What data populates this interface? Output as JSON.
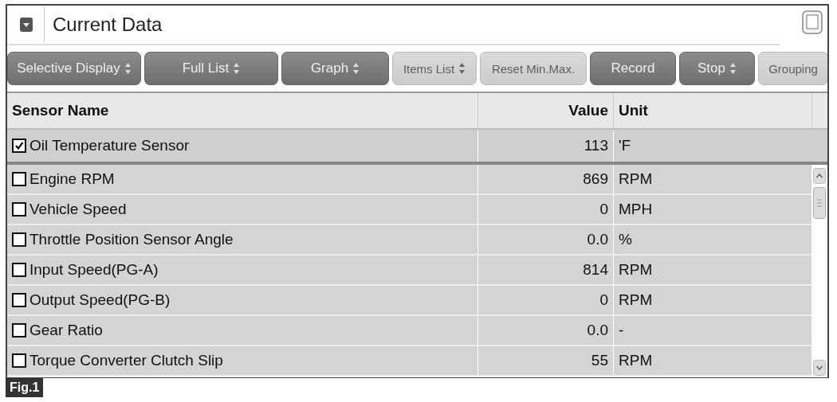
{
  "panel": {
    "title": "Current Data"
  },
  "toolbar": [
    {
      "label": "Selective Display",
      "spinner": true,
      "disabled": false
    },
    {
      "label": "Full List",
      "spinner": true,
      "disabled": false
    },
    {
      "label": "Graph",
      "spinner": true,
      "disabled": false
    },
    {
      "label": "Items List",
      "spinner": true,
      "disabled": true
    },
    {
      "label": "Reset Min.Max.",
      "spinner": false,
      "disabled": true
    },
    {
      "label": "Record",
      "spinner": false,
      "disabled": false
    },
    {
      "label": "Stop",
      "spinner": true,
      "disabled": false
    },
    {
      "label": "Grouping",
      "spinner": false,
      "disabled": true
    }
  ],
  "table": {
    "columns": [
      "Sensor Name",
      "Value",
      "Unit"
    ],
    "pinned_rows": [
      {
        "name": "Oil Temperature Sensor",
        "value": "113",
        "unit": "'F",
        "checked": true
      }
    ],
    "rows": [
      {
        "name": "Engine RPM",
        "value": "869",
        "unit": "RPM",
        "checked": false
      },
      {
        "name": "Vehicle Speed",
        "value": "0",
        "unit": "MPH",
        "checked": false
      },
      {
        "name": "Throttle Position Sensor Angle",
        "value": "0.0",
        "unit": "%",
        "checked": false
      },
      {
        "name": "Input Speed(PG-A)",
        "value": "814",
        "unit": "RPM",
        "checked": false
      },
      {
        "name": "Output Speed(PG-B)",
        "value": "0",
        "unit": "RPM",
        "checked": false
      },
      {
        "name": "Gear Ratio",
        "value": "0.0",
        "unit": "-",
        "checked": false
      },
      {
        "name": "Torque Converter Clutch Slip",
        "value": "55",
        "unit": "RPM",
        "checked": false
      }
    ]
  },
  "caption": "Fig.1"
}
